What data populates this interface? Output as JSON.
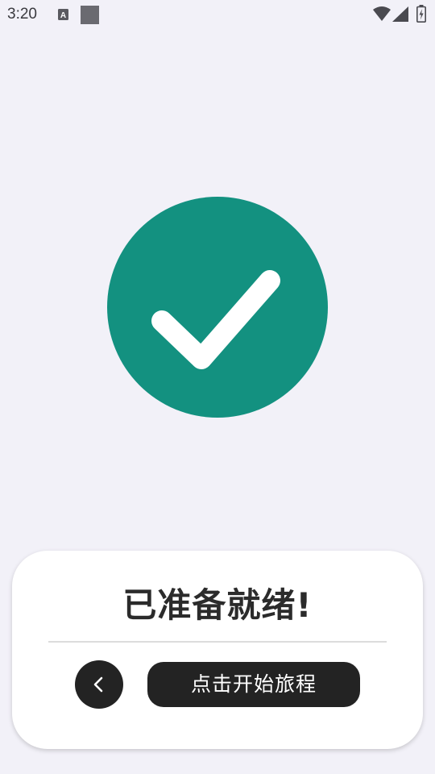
{
  "status_bar": {
    "time": "3:20",
    "icons": [
      "a-keyboard-icon",
      "square-notification-icon",
      "wifi-icon",
      "signal-icon",
      "battery-charging-icon"
    ]
  },
  "success": {
    "icon": "checkmark-icon",
    "circle_color": "#139180"
  },
  "card": {
    "title": "已准备就绪!",
    "back_icon": "chevron-left-icon",
    "start_label": "点击开始旅程"
  }
}
